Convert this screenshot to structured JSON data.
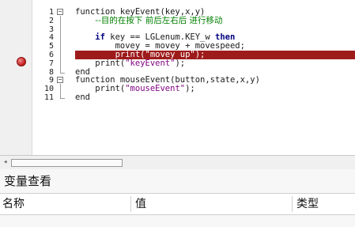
{
  "editor": {
    "lines": [
      {
        "num": "1",
        "fold": "−",
        "indent": "",
        "segments": [
          [
            "plain",
            "function keyEvent(key,x,y)"
          ]
        ]
      },
      {
        "num": "2",
        "fold": "",
        "indent": "    ",
        "segments": [
          [
            "cm",
            "--目的在按下 前后左右后 进行移动"
          ]
        ]
      },
      {
        "num": "3",
        "fold": "",
        "indent": "",
        "segments": []
      },
      {
        "num": "4",
        "fold": "",
        "indent": "    ",
        "segments": [
          [
            "kw",
            "if"
          ],
          [
            "plain",
            " key == LGLenum.KEY_w "
          ],
          [
            "kw",
            "then"
          ]
        ]
      },
      {
        "num": "5",
        "fold": "",
        "indent": "        ",
        "segments": [
          [
            "plain",
            "movey = movey + movespeed;"
          ]
        ]
      },
      {
        "num": "6",
        "fold": "",
        "indent": "        ",
        "segments": [
          [
            "plain",
            "print("
          ],
          [
            "str",
            "\"movey up\""
          ],
          [
            "plain",
            ");"
          ]
        ],
        "highlight": true
      },
      {
        "num": "7",
        "fold": "",
        "indent": "    ",
        "segments": [
          [
            "plain",
            "print("
          ],
          [
            "str",
            "\"keyEvent\""
          ],
          [
            "plain",
            ");"
          ]
        ]
      },
      {
        "num": "8",
        "fold": "",
        "indent": "",
        "segments": [
          [
            "plain",
            "end"
          ]
        ]
      },
      {
        "num": "9",
        "fold": "−",
        "indent": "",
        "segments": [
          [
            "plain",
            "function mouseEvent(button,state,x,y)"
          ]
        ]
      },
      {
        "num": "10",
        "fold": "",
        "indent": "    ",
        "segments": [
          [
            "plain",
            "print("
          ],
          [
            "str",
            "\"mouseEvent\""
          ],
          [
            "plain",
            ");"
          ]
        ]
      },
      {
        "num": "11",
        "fold": "",
        "indent": "",
        "segments": [
          [
            "plain",
            "end"
          ]
        ]
      }
    ]
  },
  "scrollbar": {
    "left_arrow": "◂"
  },
  "variables_panel": {
    "title": "变量查看",
    "columns": [
      "名称",
      "值",
      "类型"
    ]
  },
  "colors": {
    "breakpoint": "#c01818",
    "highlight": "#9e1b1b",
    "keyword": "#000080",
    "comment": "#008000",
    "string": "#7f007f"
  }
}
